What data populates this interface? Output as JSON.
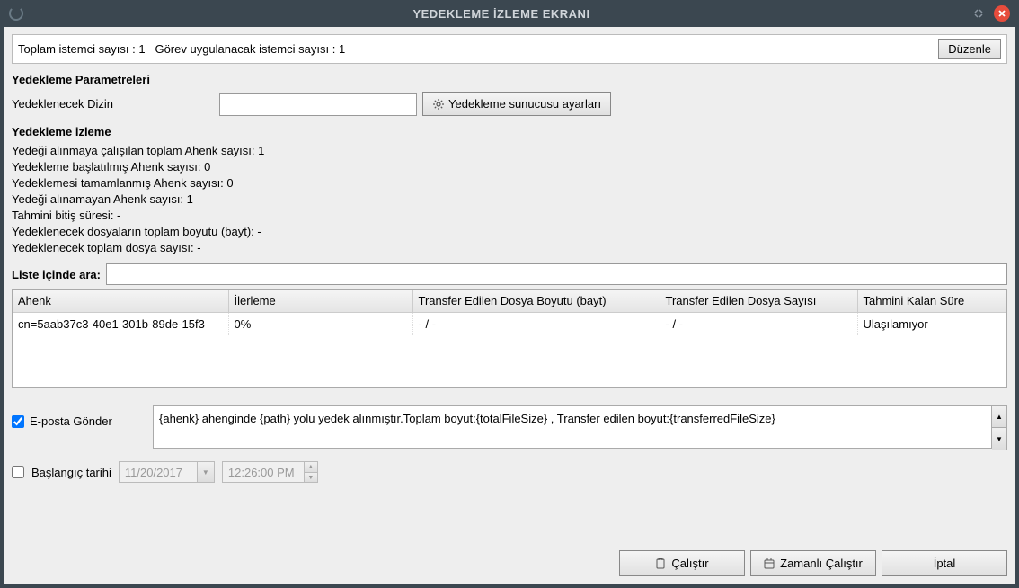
{
  "window": {
    "title": "YEDEKLEME İZLEME EKRANI"
  },
  "infobar": {
    "total_clients_label": "Toplam istemci sayısı : ",
    "total_clients_value": "1",
    "task_clients_label": "Görev uygulanacak istemci sayısı : ",
    "task_clients_value": "1",
    "edit_button": "Düzenle"
  },
  "params": {
    "section_title": "Yedekleme Parametreleri",
    "dir_label": "Yedeklenecek Dizin",
    "dir_value": "",
    "server_settings_button": "Yedekleme sunucusu ayarları"
  },
  "monitor": {
    "section_title": "Yedekleme izleme",
    "lines": {
      "l1": "Yedeği alınmaya çalışılan toplam Ahenk sayısı: 1",
      "l2": "Yedekleme başlatılmış Ahenk sayısı: 0",
      "l3": "Yedeklemesi tamamlanmış Ahenk sayısı: 0",
      "l4": "Yedeği alınamayan Ahenk sayısı: 1",
      "l5": "Tahmini bitiş süresi: -",
      "l6": "Yedeklenecek dosyaların toplam boyutu (bayt): -",
      "l7": "Yedeklenecek toplam dosya sayısı: -"
    }
  },
  "search": {
    "label": "Liste içinde ara:",
    "value": ""
  },
  "table": {
    "headers": {
      "ahenk": "Ahenk",
      "progress": "İlerleme",
      "size": "Transfer Edilen Dosya Boyutu (bayt)",
      "count": "Transfer Edilen Dosya Sayısı",
      "eta": "Tahmini Kalan Süre"
    },
    "row": {
      "ahenk": "cn=5aab37c3-40e1-301b-89de-15f3",
      "progress": "0%",
      "size": "- / -",
      "count": "- / -",
      "eta": "Ulaşılamıyor"
    }
  },
  "email": {
    "checkbox_label": "E-posta Gönder",
    "checked": true,
    "template": "{ahenk} ahenginde {path} yolu yedek alınmıştır.Toplam boyut:{totalFileSize} , Transfer edilen boyut:{transferredFileSize}"
  },
  "startdate": {
    "checkbox_label": "Başlangıç tarihi",
    "checked": false,
    "date": "11/20/2017",
    "time": "12:26:00 PM"
  },
  "footer": {
    "run": "Çalıştır",
    "run_scheduled": "Zamanlı Çalıştır",
    "cancel": "İptal"
  }
}
